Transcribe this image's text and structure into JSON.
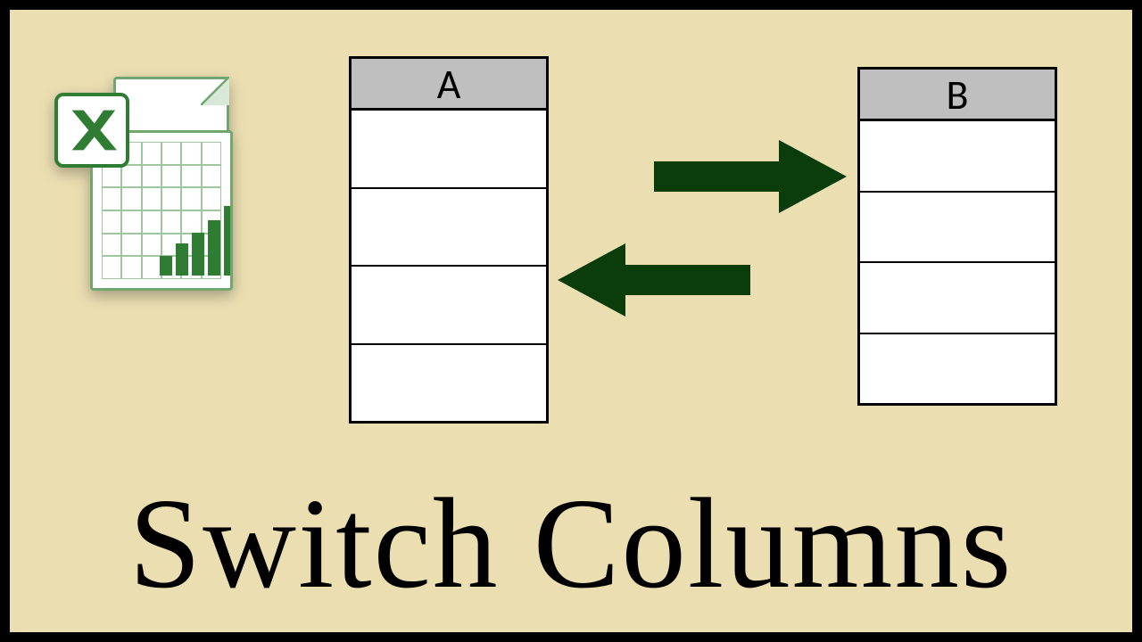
{
  "columns": {
    "a_label": "A",
    "b_label": "B"
  },
  "title": "Switch Columns",
  "icon": {
    "name": "excel-icon",
    "chart_type": "bar"
  },
  "arrows": {
    "direction1": "right",
    "direction2": "left",
    "color": "#0b3d0b"
  }
}
